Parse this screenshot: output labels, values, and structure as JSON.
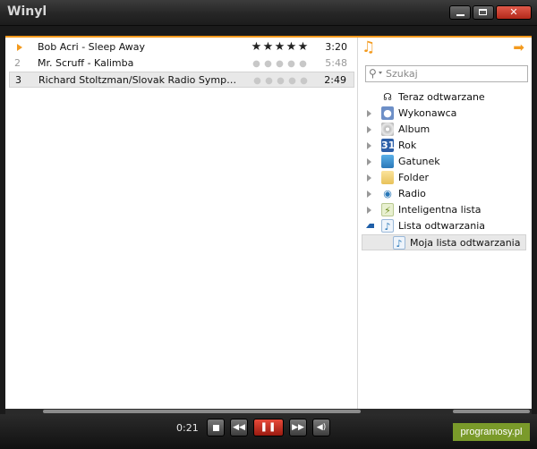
{
  "window": {
    "title": "Winyl"
  },
  "playlist": {
    "tracks": [
      {
        "num": "1",
        "title": "Bob Acri - Sleep Away",
        "rating": 5,
        "duration": "3:20",
        "playing": true
      },
      {
        "num": "2",
        "title": "Mr. Scruff - Kalimba",
        "rating": 0,
        "duration": "5:48",
        "playing": false
      },
      {
        "num": "3",
        "title": "Richard Stoltzman/Slovak Radio Symphony ...",
        "rating": 0,
        "duration": "2:49",
        "playing": false
      }
    ]
  },
  "sidebar": {
    "search_placeholder": "Szukaj",
    "items": [
      {
        "label": "Teraz odtwarzane",
        "icon": "headphones-icon"
      },
      {
        "label": "Wykonawca",
        "icon": "artist-icon"
      },
      {
        "label": "Album",
        "icon": "album-icon"
      },
      {
        "label": "Rok",
        "icon": "calendar-icon",
        "icon_text": "31"
      },
      {
        "label": "Gatunek",
        "icon": "genre-icon"
      },
      {
        "label": "Folder",
        "icon": "folder-icon"
      },
      {
        "label": "Radio",
        "icon": "radio-icon"
      },
      {
        "label": "Inteligentna lista",
        "icon": "smart-playlist-icon"
      },
      {
        "label": "Lista odtwarzania",
        "icon": "playlist-icon"
      },
      {
        "label": "Moja lista odtwarzania",
        "icon": "playlist-icon"
      }
    ]
  },
  "player": {
    "time": "0:21",
    "brand": "programosy.pl"
  },
  "colors": {
    "accent": "#f39a1e",
    "play_button": "#d8321f",
    "badge": "#7a9a2a"
  }
}
